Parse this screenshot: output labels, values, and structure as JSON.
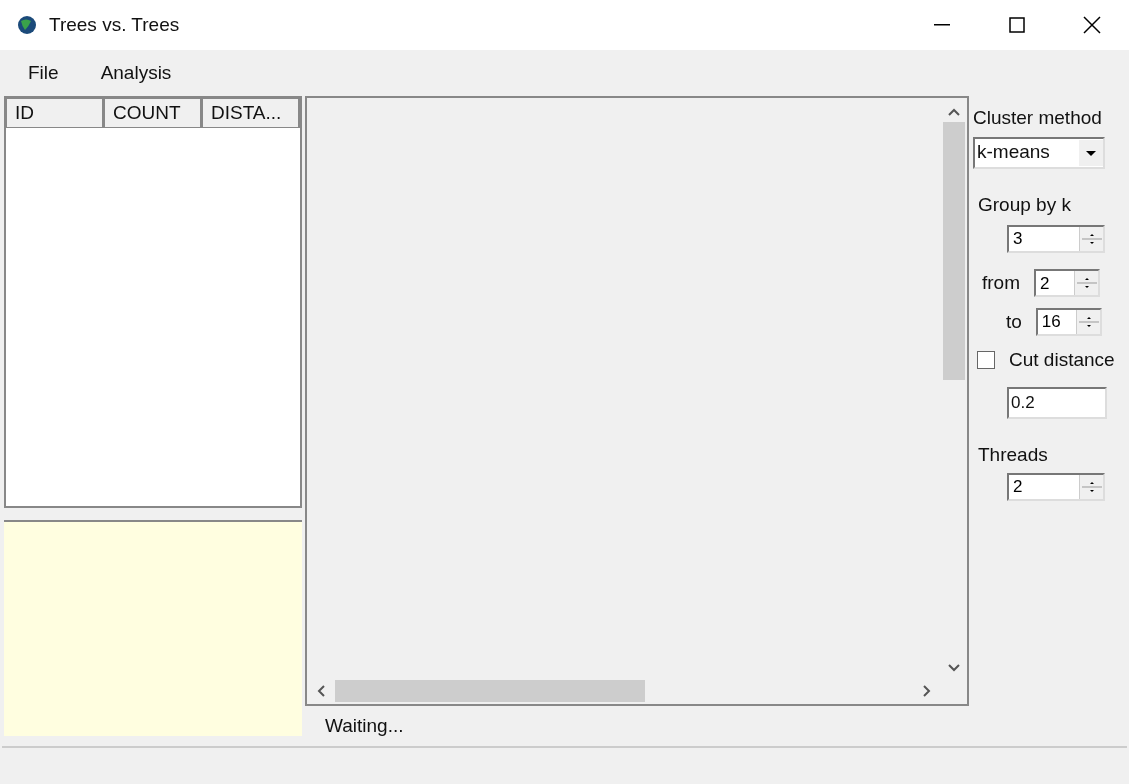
{
  "window": {
    "title": "Trees vs. Trees"
  },
  "menu": [
    {
      "label": "File"
    },
    {
      "label": "Analysis"
    }
  ],
  "table": {
    "columns": [
      "ID",
      "COUNT",
      "DISTA..."
    ]
  },
  "status": "Waiting...",
  "cluster_method": {
    "label": "Cluster method",
    "value": "k-means"
  },
  "group_by_k": {
    "label": "Group by k",
    "value": "3"
  },
  "from": {
    "label": "from",
    "value": "2"
  },
  "to": {
    "label": "to",
    "value": "16"
  },
  "cut_distance": {
    "label": "Cut distance",
    "checked": false,
    "value": "0.2"
  },
  "threads": {
    "label": "Threads",
    "value": "2"
  }
}
